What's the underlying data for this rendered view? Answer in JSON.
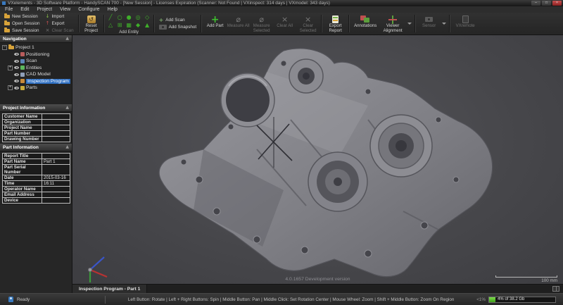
{
  "window": {
    "title": "VXelements - 3D Software Platform - HandySCAN 700 - [New Session] - Licenses Expiration (Scanner: Not Found | VXinspect: 314 days | VXmodel: 343 days)",
    "controls": {
      "minimize": "–",
      "maximize": "□",
      "close": "×"
    }
  },
  "menubar": {
    "items": [
      "File",
      "Edit",
      "Project",
      "View",
      "Configure",
      "Help"
    ]
  },
  "toolbar": {
    "session_buttons": [
      "New Session",
      "Open Session",
      "Save Session"
    ],
    "io_buttons": [
      "Import",
      "Export",
      "Clear Scan"
    ],
    "reset_button": "Reset Project",
    "entity_group_label": "Add Entity",
    "entity_glyphs": [
      "╱",
      "○",
      "●",
      "◎",
      "◇",
      "△",
      "⊞",
      "▦",
      "◆",
      "▲"
    ],
    "scan_buttons": [
      "Add Scan",
      "Add Snapshot"
    ],
    "big_buttons": [
      "Add Part",
      "Measure All",
      "Measure Selected",
      "Clear All",
      "Clear Selected",
      "Export Report",
      "Annotations",
      "Viewer Alignment",
      "Sensor",
      "VXremote"
    ]
  },
  "icons": {
    "import_glyph": "↓",
    "export_glyph": "↑",
    "clear_scan_glyph": "×",
    "reset_glyph": "↺",
    "add_part_glyph": "+",
    "add_scan_glyph": "+",
    "measure_glyph": "⌀",
    "clear_glyph": "×",
    "panel_collapse_glyph": "▲",
    "expand_open": "−",
    "expand_closed": "+"
  },
  "navigation": {
    "header": "Navigation",
    "items": [
      {
        "label": "Project 1"
      },
      {
        "label": "Positioning"
      },
      {
        "label": "Scan"
      },
      {
        "label": "Entities"
      },
      {
        "label": "CAD Model"
      },
      {
        "label": "Inspection Program"
      },
      {
        "label": "Parts"
      }
    ]
  },
  "project_info": {
    "header": "Project Information",
    "rows": [
      {
        "label": "Customer Name",
        "value": ""
      },
      {
        "label": "Organization",
        "value": ""
      },
      {
        "label": "Project Name",
        "value": ""
      },
      {
        "label": "Part Number",
        "value": ""
      },
      {
        "label": "Drawing Number",
        "value": ""
      }
    ]
  },
  "part_info": {
    "header": "Part Information",
    "rows": [
      {
        "label": "Report Title",
        "value": ""
      },
      {
        "label": "Part Name",
        "value": "Part 1"
      },
      {
        "label": "Part Serial Number",
        "value": ""
      },
      {
        "label": "Date",
        "value": "2015-03-16"
      },
      {
        "label": "Time",
        "value": "16:11"
      },
      {
        "label": "Operator Name",
        "value": ""
      },
      {
        "label": "Email Address",
        "value": ""
      },
      {
        "label": "Device",
        "value": ""
      }
    ]
  },
  "viewport": {
    "version_label": "4.0.1657 Development version",
    "scale_label": "100 mm",
    "tab_label": "Inspection Program - Part 1"
  },
  "statusbar": {
    "ready": "Ready",
    "hints": "Left Button: Rotate  |  Left + Right Buttons: Spin  |  Middle Button: Pan  |  Middle Click: Set Rotation Center  |  Mouse Wheel: Zoom  |  Shift + Middle Button: Zoom On Region",
    "cpu": "<1%",
    "memory": "4% of 38.2 Gb"
  }
}
